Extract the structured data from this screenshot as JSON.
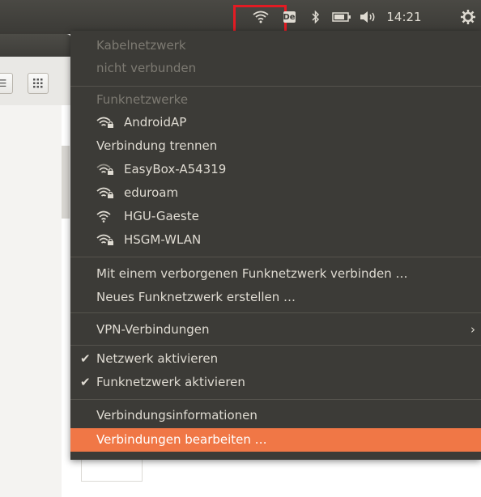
{
  "panel": {
    "clock": "14:21",
    "keyboard_layout": "De",
    "icons": [
      "wifi-icon",
      "bluetooth-icon",
      "battery-icon",
      "volume-icon",
      "settings-gear-icon"
    ]
  },
  "menu": {
    "wired_header": "Kabelnetzwerk",
    "wired_status": "nicht verbunden",
    "wireless_header": "Funknetzwerke",
    "connected_network": "AndroidAP",
    "disconnect": "Verbindung trennen",
    "networks": [
      "EasyBox-A54319",
      "eduroam",
      "HGU-Gaeste",
      "HSGM-WLAN"
    ],
    "connect_hidden": "Mit einem verborgenen Funknetzwerk verbinden …",
    "create_new": "Neues Funknetzwerk erstellen …",
    "vpn": "VPN-Verbindungen",
    "enable_network": "Netzwerk aktivieren",
    "enable_wireless": "Funknetzwerk aktivieren",
    "connection_info": "Verbindungsinformationen",
    "edit_connections": "Verbindungen bearbeiten …"
  },
  "colors": {
    "panel_bg": "#3b3a36",
    "menu_bg": "#3c3b37",
    "highlight": "#f07746",
    "annotation_box": "#e31b23"
  }
}
